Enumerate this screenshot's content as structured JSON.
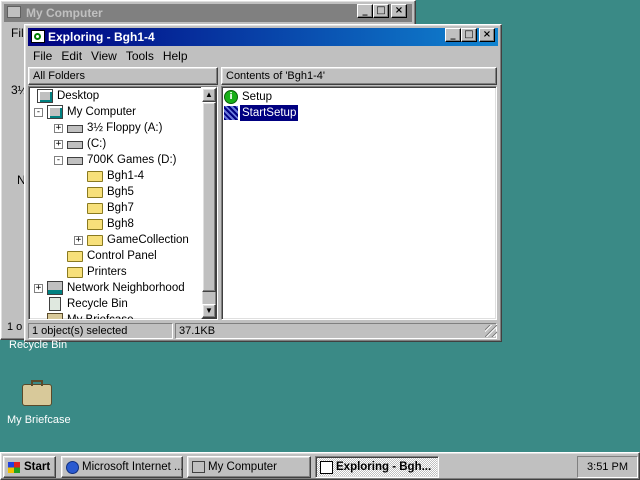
{
  "background_window": {
    "title": "My Computer",
    "partial_texts": [
      "Fil",
      "3½",
      "N",
      "1 o"
    ]
  },
  "window": {
    "title": "Exploring - Bgh1-4",
    "menu": [
      "File",
      "Edit",
      "View",
      "Tools",
      "Help"
    ],
    "all_folders_label": "All Folders",
    "contents_label": "Contents of 'Bgh1-4'",
    "tree": [
      {
        "label": "Desktop",
        "icon": "desktop-icon"
      },
      {
        "label": "My Computer",
        "icon": "computer-icon"
      },
      {
        "label": "3½ Floppy (A:)",
        "icon": "floppy-drive-icon"
      },
      {
        "label": "(C:)",
        "icon": "hard-drive-icon"
      },
      {
        "label": "700K Games (D:)",
        "icon": "cd-drive-icon"
      },
      {
        "label": "Bgh1-4",
        "icon": "open-folder-icon"
      },
      {
        "label": "Bgh5",
        "icon": "folder-icon"
      },
      {
        "label": "Bgh7",
        "icon": "folder-icon"
      },
      {
        "label": "Bgh8",
        "icon": "folder-icon"
      },
      {
        "label": "GameCollection",
        "icon": "folder-icon"
      },
      {
        "label": "Control Panel",
        "icon": "control-panel-icon"
      },
      {
        "label": "Printers",
        "icon": "printers-folder-icon"
      },
      {
        "label": "Network Neighborhood",
        "icon": "network-icon"
      },
      {
        "label": "Recycle Bin",
        "icon": "recycle-bin-icon"
      },
      {
        "label": "My Briefcase",
        "icon": "briefcase-icon"
      }
    ],
    "contents": [
      {
        "label": "Setup",
        "icon": "setup-icon"
      },
      {
        "label": "StartSetup",
        "icon": "setup-program-icon"
      }
    ],
    "status": {
      "selected": "1 object(s) selected",
      "size": "37.1KB"
    }
  },
  "desktop_icons": [
    {
      "label": "Recycle Bin",
      "icon": "recycle-bin-icon"
    },
    {
      "label": "My Briefcase",
      "icon": "briefcase-icon"
    }
  ],
  "taskbar": {
    "start": "Start",
    "buttons": [
      {
        "label": "Microsoft Internet ...",
        "icon": "internet-explorer-icon"
      },
      {
        "label": "My Computer",
        "icon": "computer-icon"
      },
      {
        "label": "Exploring - Bgh...",
        "icon": "explorer-icon"
      }
    ],
    "clock": "3:51 PM"
  },
  "colors": {
    "desktop": "#3a8a86",
    "title_active": "#000080",
    "title_inactive": "#808080",
    "selection": "#000080"
  }
}
